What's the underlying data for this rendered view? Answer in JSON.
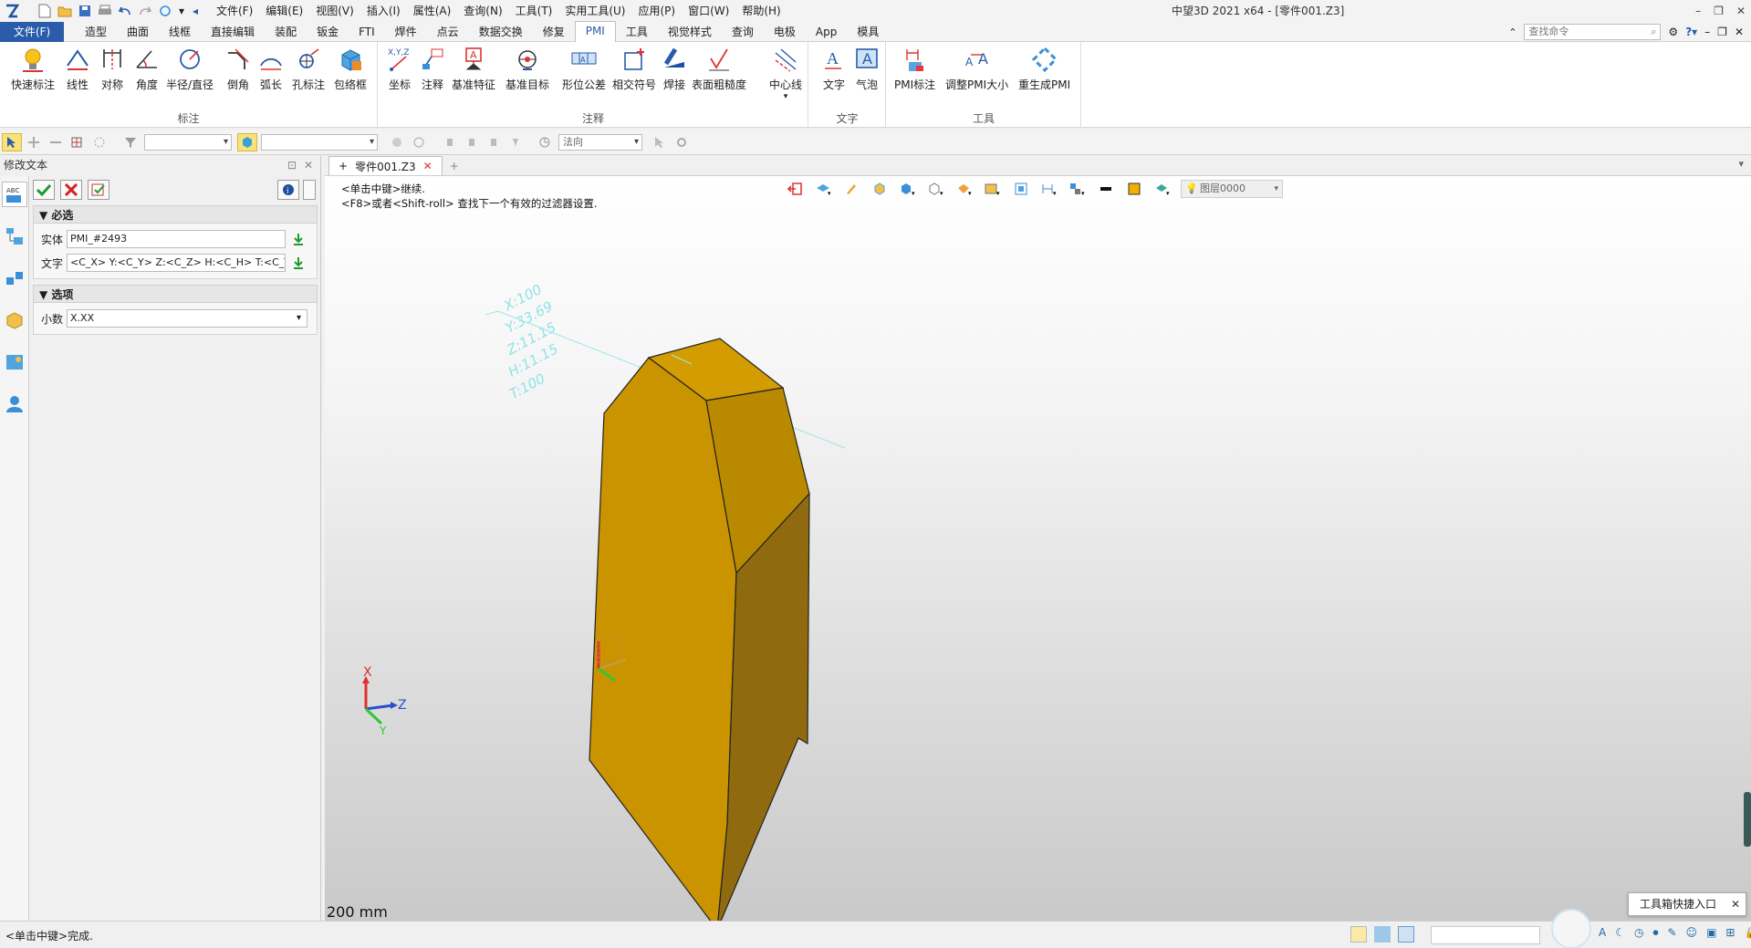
{
  "titlebar": {
    "menus": [
      "文件(F)",
      "编辑(E)",
      "视图(V)",
      "插入(I)",
      "属性(A)",
      "查询(N)",
      "工具(T)",
      "实用工具(U)",
      "应用(P)",
      "窗口(W)",
      "帮助(H)"
    ],
    "app_title": "中望3D 2021 x64 - [零件001.Z3]"
  },
  "ribbon_tabs": {
    "file": "文件(F)",
    "tabs": [
      "造型",
      "曲面",
      "线框",
      "直接编辑",
      "装配",
      "钣金",
      "FTI",
      "焊件",
      "点云",
      "数据交换",
      "修复",
      "PMI",
      "工具",
      "视觉样式",
      "查询",
      "电极",
      "App",
      "模具"
    ],
    "active": "PMI",
    "search_placeholder": "查找命令"
  },
  "ribbon": {
    "groups": {
      "dimension": "标注",
      "annotation": "注释",
      "text": "文字",
      "tools": "工具"
    },
    "buttons": {
      "quick_dim": "快速标注",
      "linear": "线性",
      "symmetric": "对称",
      "angle": "角度",
      "radius": "半径/直径",
      "chamfer": "倒角",
      "arc_length": "弧长",
      "hole": "孔标注",
      "bbox": "包络框",
      "coord": "坐标",
      "note": "注释",
      "datum_feature": "基准特征",
      "datum_target": "基准目标",
      "gdt": "形位公差",
      "intersection": "相交符号",
      "weld": "焊接",
      "roughness": "表面粗糙度",
      "centerline": "中心线",
      "text": "文字",
      "balloon": "气泡",
      "pmi_dim": "PMI标注",
      "pmi_size": "调整PMI大小",
      "regen_pmi": "重生成PMI"
    }
  },
  "toolbar2": {
    "normal_combo": "法向"
  },
  "left_panel": {
    "title": "修改文本",
    "required_header": "必选",
    "entity_label": "实体",
    "entity_value": "PMI_#2493",
    "text_label": "文字",
    "text_value": "<C_X> Y:<C_Y> Z:<C_Z> H:<C_H> T:<C_T>",
    "options_header": "选项",
    "decimal_label": "小数",
    "decimal_value": "X.XX"
  },
  "doc_tab": {
    "name": "零件001.Z3"
  },
  "viewport": {
    "hint_line1": "<单击中键>继续.",
    "hint_line2": "<F8>或者<Shift-roll> 查找下一个有效的过滤器设置.",
    "layer": "图层0000",
    "scale": "200 mm",
    "axes": {
      "x": "X",
      "y": "Y",
      "z": "Z"
    },
    "pmi_lines": [
      "X:100",
      "Y:33.69",
      "Z:11.15",
      "H:11.15",
      "T:100"
    ],
    "colors": {
      "face_top": "#d39c00",
      "face_left": "#c99400",
      "face_front": "#b98a00",
      "face_right": "#8f6a0f",
      "pmi": "#8fe3e8"
    }
  },
  "statusbar": {
    "text": "<单击中键>完成.",
    "toolbox_tip": "工具箱快捷入口"
  }
}
